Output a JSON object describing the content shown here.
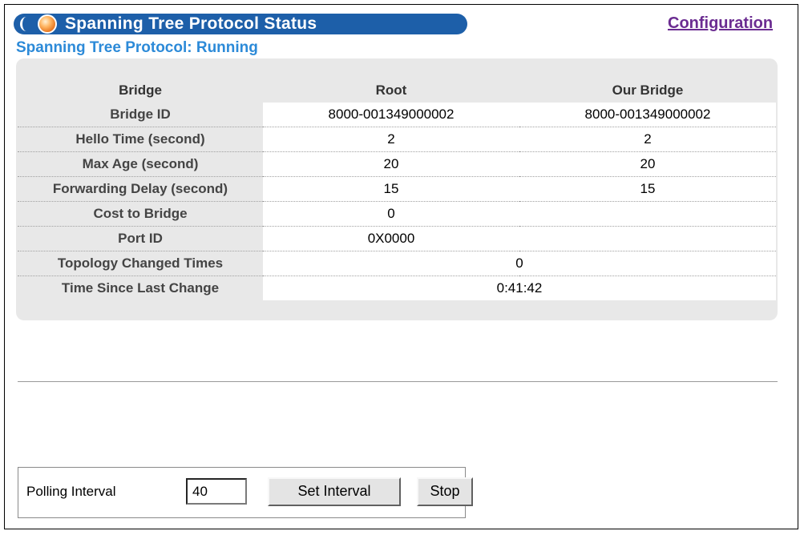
{
  "header": {
    "title": "Spanning Tree Protocol Status",
    "config_link": "Configuration",
    "status": "Spanning Tree Protocol: Running"
  },
  "table": {
    "columns": [
      "Bridge",
      "Root",
      "Our Bridge"
    ],
    "rows": [
      {
        "label": "Bridge ID",
        "root": "8000-001349000002",
        "ours": "8000-001349000002"
      },
      {
        "label": "Hello Time (second)",
        "root": "2",
        "ours": "2"
      },
      {
        "label": "Max Age (second)",
        "root": "20",
        "ours": "20"
      },
      {
        "label": "Forwarding Delay (second)",
        "root": "15",
        "ours": "15"
      },
      {
        "label": "Cost to Bridge",
        "root": "0",
        "ours": ""
      },
      {
        "label": "Port ID",
        "root": "0X0000",
        "ours": ""
      },
      {
        "label": "Topology Changed Times",
        "value": "0"
      },
      {
        "label": "Time Since Last Change",
        "value": "0:41:42"
      }
    ]
  },
  "polling": {
    "label": "Polling Interval",
    "value": "40",
    "set_button": "Set Interval",
    "stop_button": "Stop"
  },
  "colors": {
    "title_bar": "#1d5fa9",
    "status_text": "#2c8ad8",
    "link": "#6b2c91",
    "panel": "#e8e8e8"
  }
}
